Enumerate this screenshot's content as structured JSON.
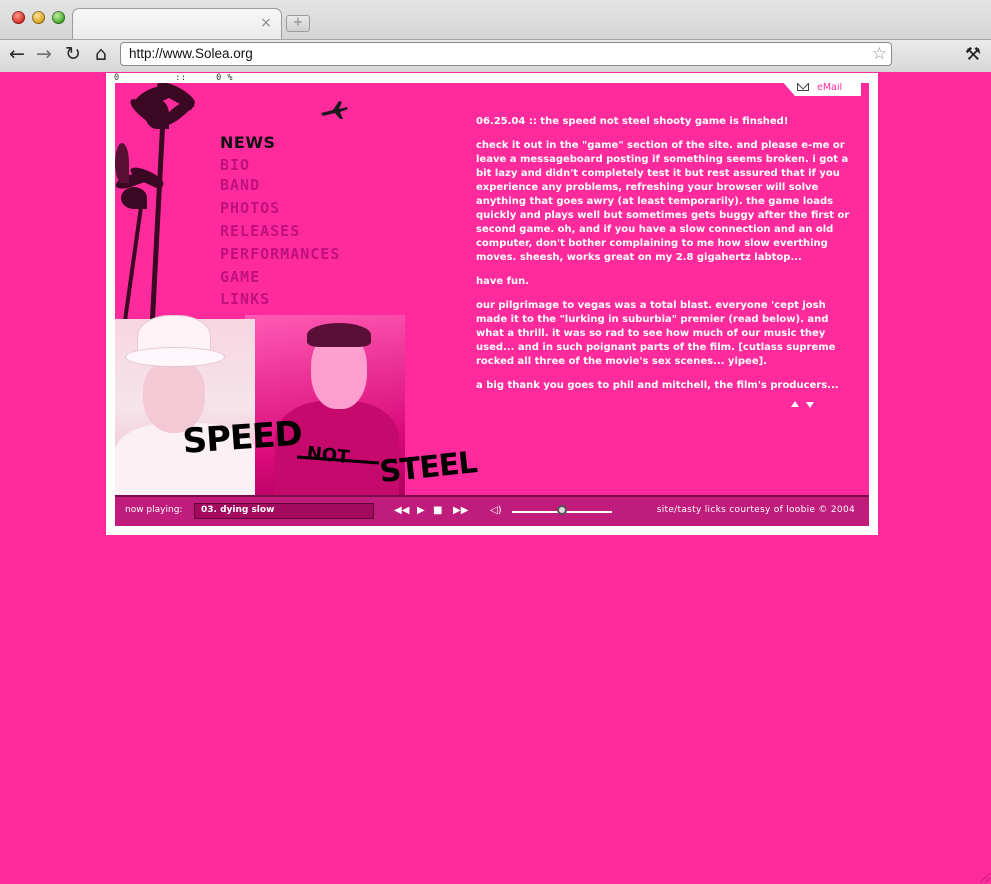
{
  "browser": {
    "url": "http://www.Solea.org",
    "new_tab_symbol": "+",
    "tab_close_symbol": "×"
  },
  "loader": {
    "left": "0",
    "sep": "::",
    "percent": "0 %"
  },
  "email_label": "eMail",
  "menu": {
    "items": [
      {
        "label": "NEWS",
        "active": true
      },
      {
        "label": "BIO"
      },
      {
        "label": "BAND"
      },
      {
        "label": "PHOTOS"
      },
      {
        "label": "RELEASES"
      },
      {
        "label": "PERFORMANCES"
      },
      {
        "label": "GAME"
      },
      {
        "label": "LINKS"
      }
    ]
  },
  "logo_text": "SPEED NOT STEEL",
  "news": {
    "headline": "06.25.04 :: the speed not steel shooty game is finshed!",
    "paragraphs": [
      "check it out in the \"game\" section of the site. and please e-me or leave a messageboard posting if something seems broken. i got a bit lazy and didn't completely test it but rest assured that if you experience any problems, refreshing your browser will solve anything that goes awry (at least temporarily). the game loads quickly and plays well but sometimes gets buggy after the first or second game. oh, and if you have a slow  connection and an old computer, don't bother complaining to me how slow everthing moves. sheesh, works great on my 2.8 gigahertz labtop...",
      "have fun.",
      "our pilgrimage to vegas was a total blast. everyone 'cept  josh made it to the \"lurking in suburbia\" premier (read below). and what a thrill. it was so rad to see how much of our music they used... and in such poignant parts of the film. [cutlass supreme rocked all three of the movie's sex scenes... yipee].",
      "a big thank you goes to  phil and mitchell, the film's producers..."
    ]
  },
  "player": {
    "now_playing_label": "now playing:",
    "track": "03. dying slow",
    "volume_fraction": 0.5,
    "credits": "site/tasty licks courtesy of loobie  ©  2004"
  },
  "colors": {
    "background": "#ff2b9d",
    "player_bar": "#c01c7c"
  }
}
